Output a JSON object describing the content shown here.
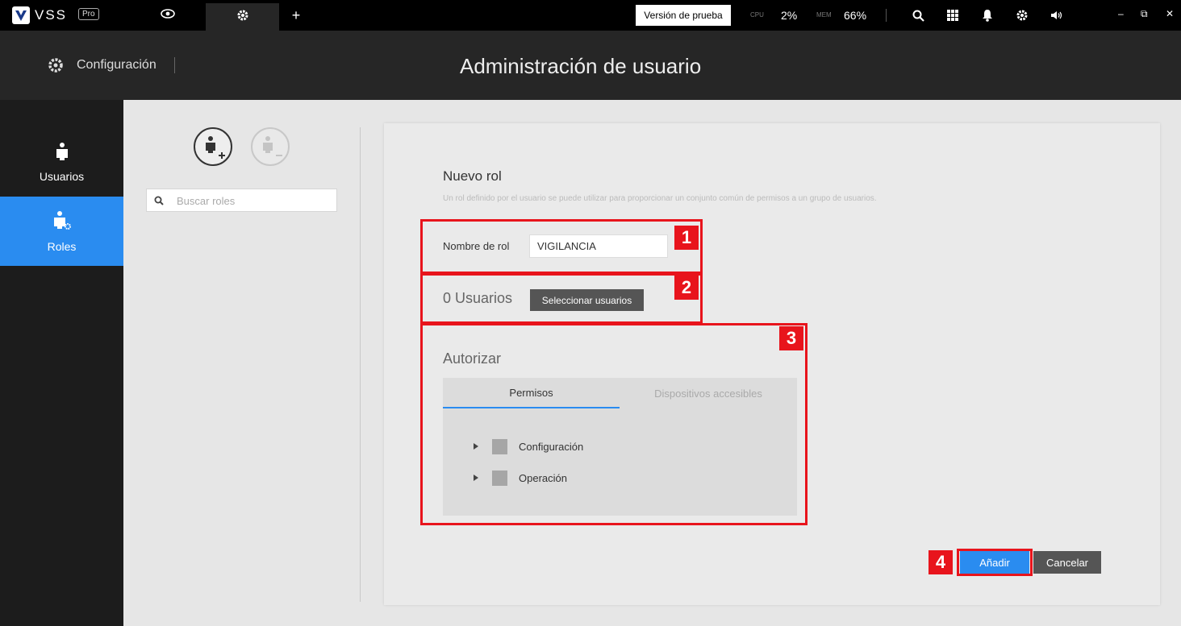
{
  "topbar": {
    "logo_text": "VSS",
    "logo_badge": "Pro",
    "add_tab": "+",
    "trial_button": "Versión de prueba",
    "cpu_label": "CPU",
    "cpu_value": "2%",
    "mem_label": "MEM",
    "mem_value": "66%",
    "icons": [
      "eye-icon",
      "gear-icon",
      "search-icon",
      "grid-icon",
      "bell-icon",
      "gear-icon",
      "volume-icon"
    ],
    "window_controls": {
      "minimize": "–",
      "restore": "⧉",
      "close": "✕"
    }
  },
  "header": {
    "section": "Configuración",
    "title": "Administración de usuario"
  },
  "sidebar": {
    "items": [
      {
        "label": "Usuarios",
        "active": false
      },
      {
        "label": "Roles",
        "active": true
      }
    ]
  },
  "roles_panel": {
    "search_placeholder": "Buscar roles"
  },
  "form": {
    "title": "Nuevo rol",
    "description": "Un rol definido por el usuario se puede utilizar para proporcionar un conjunto común de permisos a un grupo de usuarios.",
    "role_name_label": "Nombre de rol",
    "role_name_value": "VIGILANCIA",
    "users_count": "0 Usuarios",
    "select_users_button": "Seleccionar usuarios",
    "authorize_title": "Autorizar",
    "tabs": [
      {
        "label": "Permisos",
        "active": true
      },
      {
        "label": "Dispositivos accesibles",
        "active": false
      }
    ],
    "tree": [
      {
        "label": "Configuración"
      },
      {
        "label": "Operación"
      }
    ],
    "add_button": "Añadir",
    "cancel_button": "Cancelar"
  },
  "callouts": [
    "1",
    "2",
    "3",
    "4"
  ],
  "colors": {
    "accent": "#2a8cf0",
    "callout": "#e8141c",
    "topbar": "#000000",
    "header": "#262626",
    "sidebar": "#1c1c1c"
  }
}
